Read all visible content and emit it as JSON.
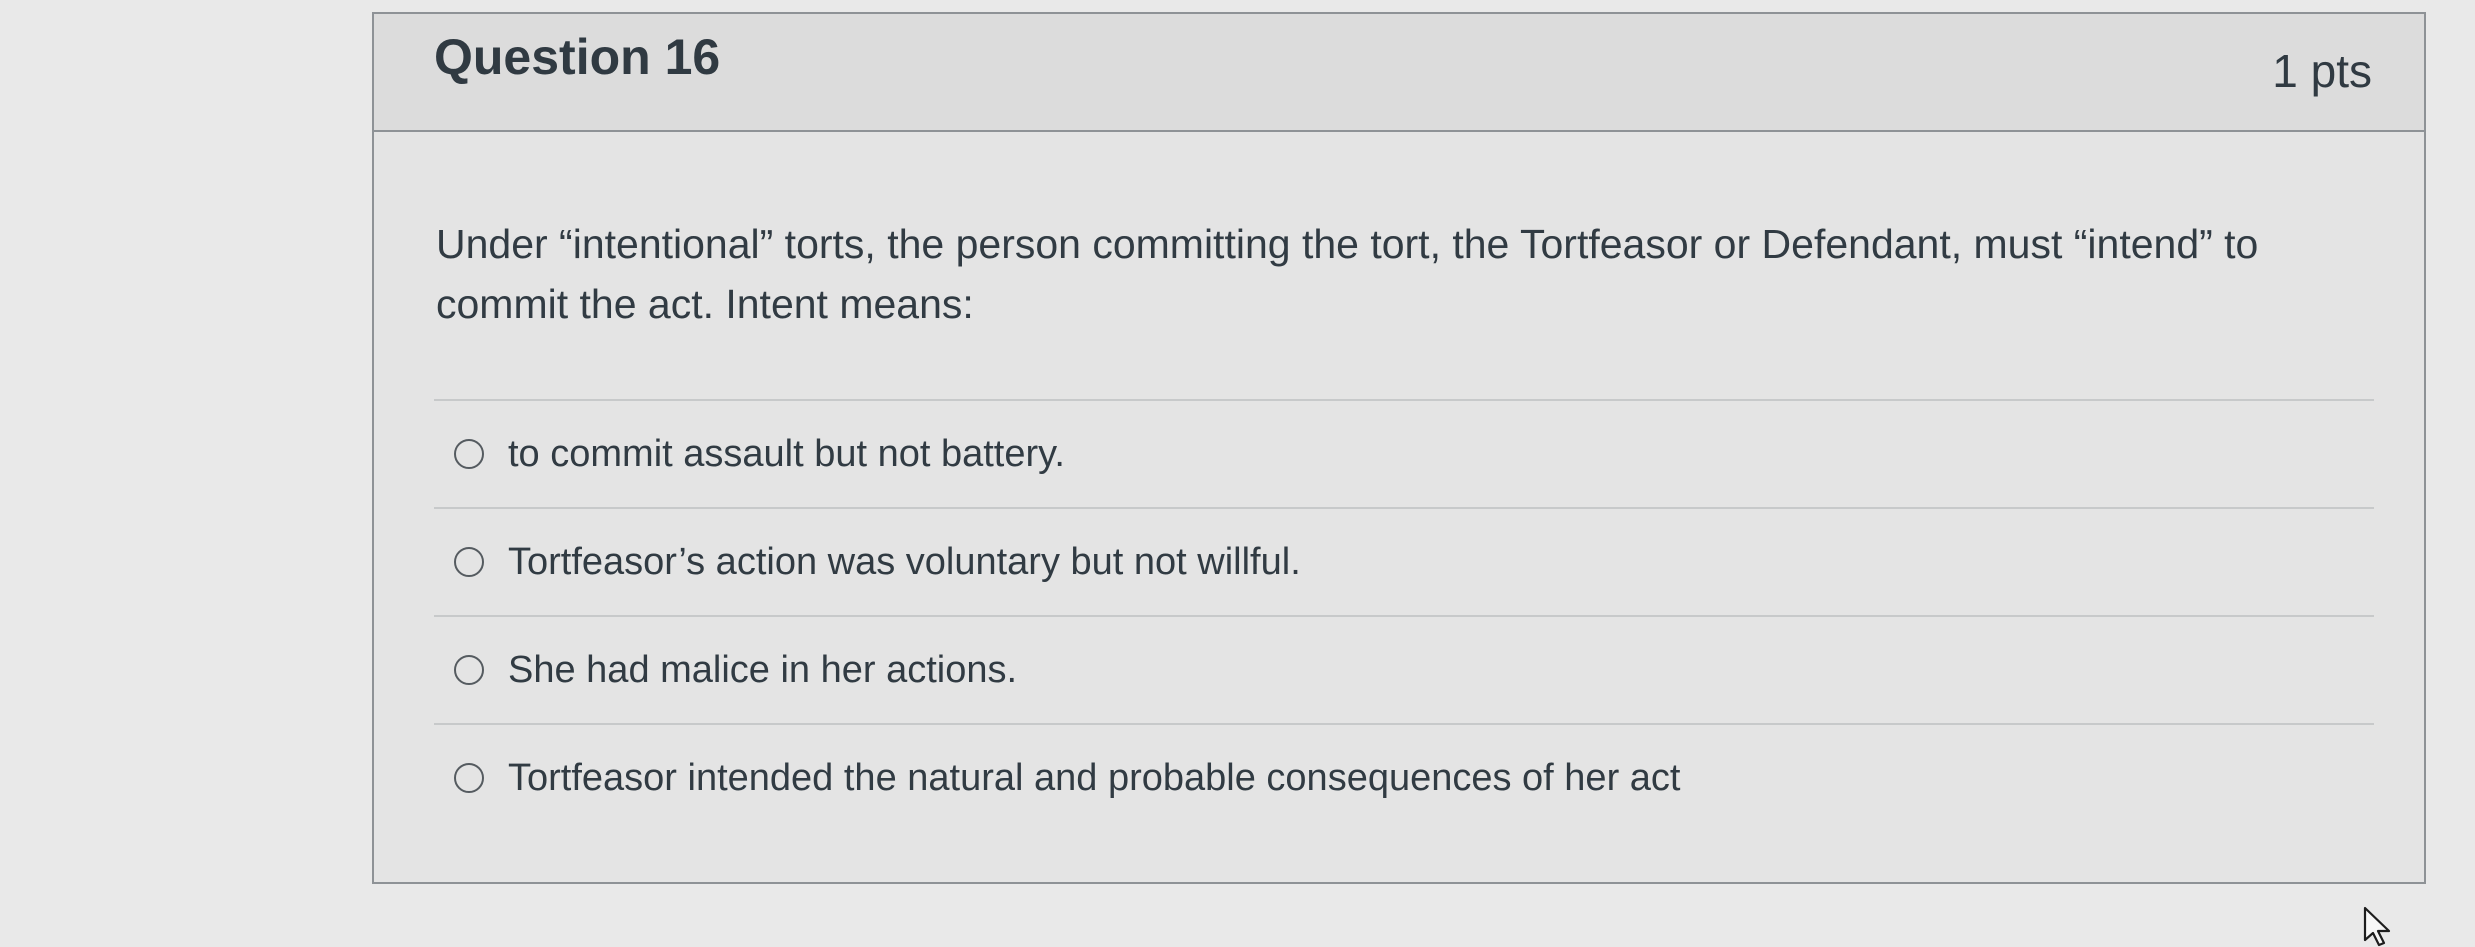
{
  "question": {
    "title": "Question 16",
    "points": "1 pts",
    "text": "Under “intentional” torts, the person committing the tort, the Tortfeasor or Defendant, must “intend” to commit the act. Intent means:",
    "answers": [
      {
        "label": "to commit assault but not battery.",
        "selected": false
      },
      {
        "label": "Tortfeasor’s action was voluntary but not willful.",
        "selected": false
      },
      {
        "label": "She had malice in her actions.",
        "selected": false
      },
      {
        "label": "Tortfeasor intended the natural and probable consequences of her act",
        "selected": false
      }
    ]
  },
  "icons": {
    "radio": "radio-button-icon",
    "cursor": "mouse-pointer-icon"
  },
  "colors": {
    "background": "#e9e9e9",
    "card_border": "#8e9296",
    "header_background": "#dcdcdc",
    "text": "#313b43"
  }
}
